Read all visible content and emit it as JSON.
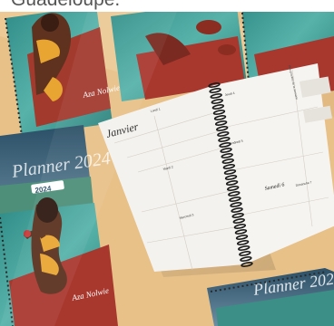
{
  "caption": "Guadeloupe.",
  "planner": {
    "month": "Janvier",
    "weekday_header": "Mes priorités de la semaine",
    "days": [
      "Lundi 1",
      "Mardi 2",
      "Mercredi 3",
      "Jeudi 4",
      "Vendredi 5",
      "Samedi 6",
      "Dimanche 7"
    ],
    "cover_brand": "Aza Nolwie",
    "cover_title": "Planner 2024",
    "year": "2024"
  },
  "colors": {
    "background": "#e9c38a",
    "water": "#3a9a94",
    "boat": "#a8382e",
    "skin": "#6b3a26",
    "paper": "#f4f2ee",
    "spiral": "#1d1d1d"
  }
}
